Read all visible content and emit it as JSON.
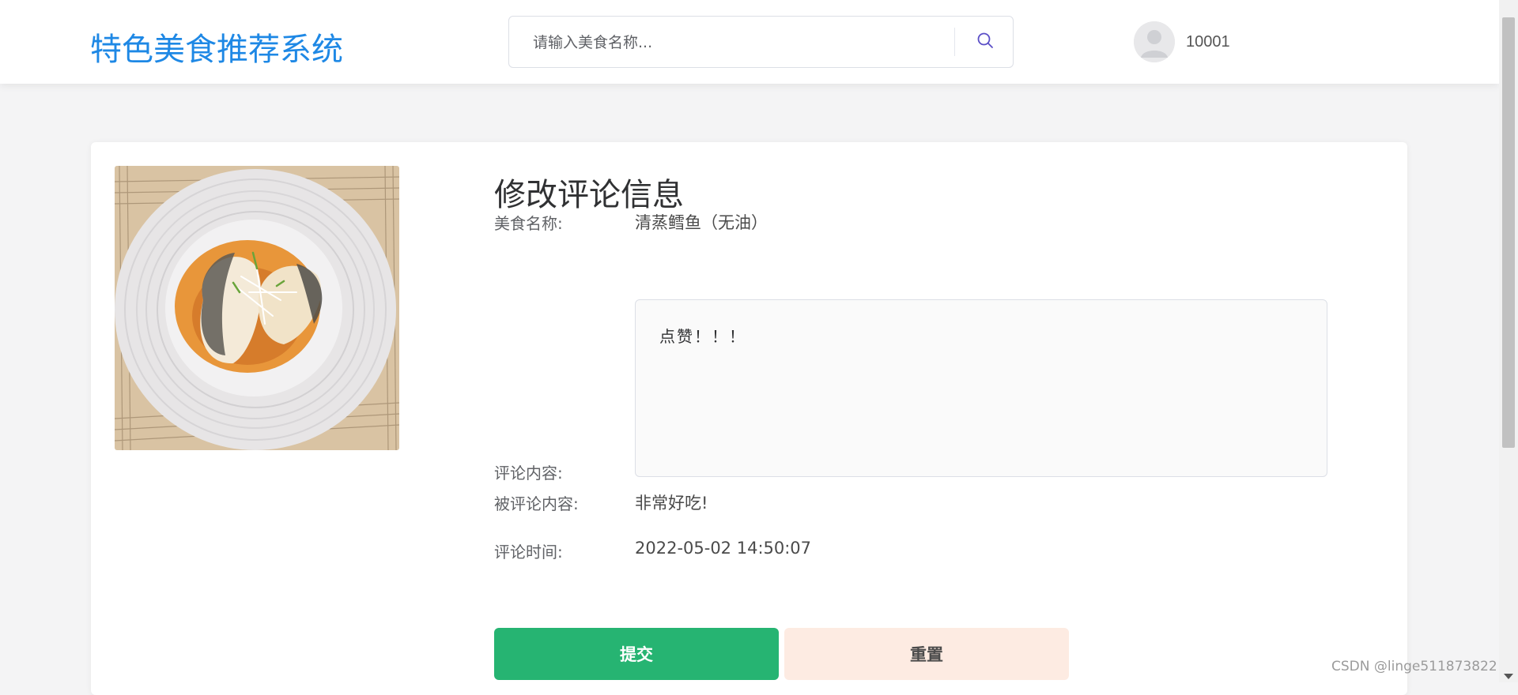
{
  "header": {
    "logo": "特色美食推荐系统",
    "search_placeholder": "请输入美食名称...",
    "search_icon": "search-icon",
    "username": "10001",
    "avatar_icon": "default-user-avatar"
  },
  "form": {
    "title": "修改评论信息",
    "food_name_label": "美食名称:",
    "food_name_value": "清蒸鳕鱼（无油）",
    "comment_label": "评论内容:",
    "comment_value": "点赞！！！",
    "replied_label": "被评论内容:",
    "replied_value": "非常好吃!",
    "time_label": "评论时间:",
    "time_value": "2022-05-02 14:50:07",
    "submit_label": "提交",
    "reset_label": "重置"
  },
  "watermark": "CSDN @linge511873822",
  "colors": {
    "logo": "#1e88e5",
    "submit": "#26b472",
    "reset": "#fdebe2",
    "search_icon": "#5b4fc7"
  }
}
